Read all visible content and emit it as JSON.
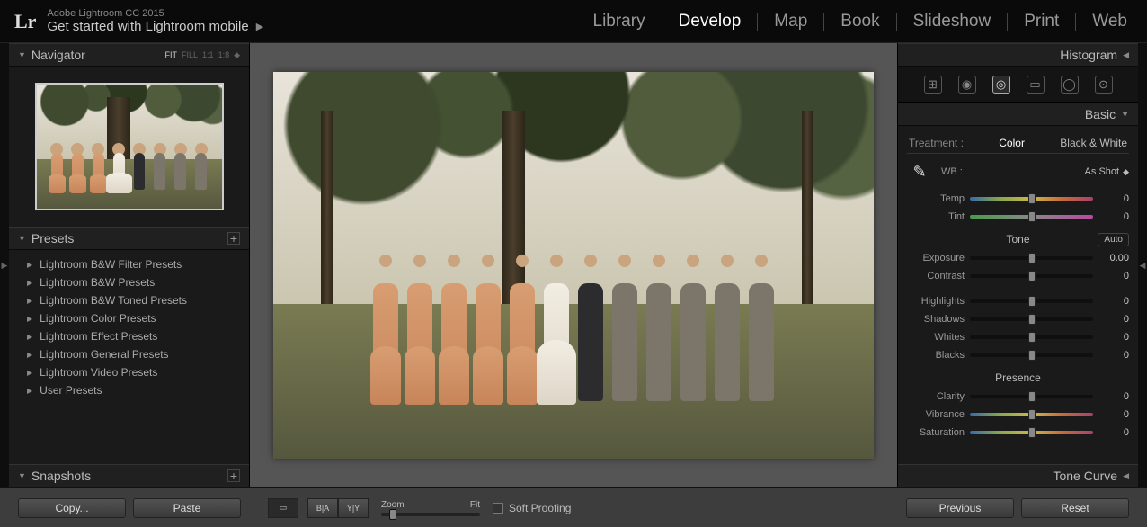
{
  "app": {
    "name": "Adobe Lightroom CC 2015",
    "subtitle": "Get started with Lightroom mobile",
    "logo": "Lr"
  },
  "modules": [
    "Library",
    "Develop",
    "Map",
    "Book",
    "Slideshow",
    "Print",
    "Web"
  ],
  "active_module": "Develop",
  "navigator": {
    "title": "Navigator",
    "zoom_opts": [
      "FIT",
      "FILL",
      "1:1",
      "1:8"
    ],
    "zoom_active": "FIT"
  },
  "presets": {
    "title": "Presets",
    "items": [
      "Lightroom B&W Filter Presets",
      "Lightroom B&W Presets",
      "Lightroom B&W Toned Presets",
      "Lightroom Color Presets",
      "Lightroom Effect Presets",
      "Lightroom General Presets",
      "Lightroom Video Presets",
      "User Presets"
    ]
  },
  "snapshots": {
    "title": "Snapshots"
  },
  "bottom": {
    "copy": "Copy...",
    "paste": "Paste",
    "zoom_label": "Zoom",
    "zoom_fit": "Fit",
    "soft_proof": "Soft Proofing",
    "previous": "Previous",
    "reset": "Reset"
  },
  "right": {
    "histogram": "Histogram",
    "basic": "Basic",
    "tone_curve": "Tone Curve",
    "treatment": {
      "label": "Treatment :",
      "color": "Color",
      "bw": "Black & White"
    },
    "wb": {
      "label": "WB :",
      "value": "As Shot"
    },
    "sliders": {
      "temp": {
        "label": "Temp",
        "value": "0"
      },
      "tint": {
        "label": "Tint",
        "value": "0"
      },
      "tone_title": "Tone",
      "auto": "Auto",
      "exposure": {
        "label": "Exposure",
        "value": "0.00"
      },
      "contrast": {
        "label": "Contrast",
        "value": "0"
      },
      "highlights": {
        "label": "Highlights",
        "value": "0"
      },
      "shadows": {
        "label": "Shadows",
        "value": "0"
      },
      "whites": {
        "label": "Whites",
        "value": "0"
      },
      "blacks": {
        "label": "Blacks",
        "value": "0"
      },
      "presence_title": "Presence",
      "clarity": {
        "label": "Clarity",
        "value": "0"
      },
      "vibrance": {
        "label": "Vibrance",
        "value": "0"
      },
      "saturation": {
        "label": "Saturation",
        "value": "0"
      }
    }
  }
}
